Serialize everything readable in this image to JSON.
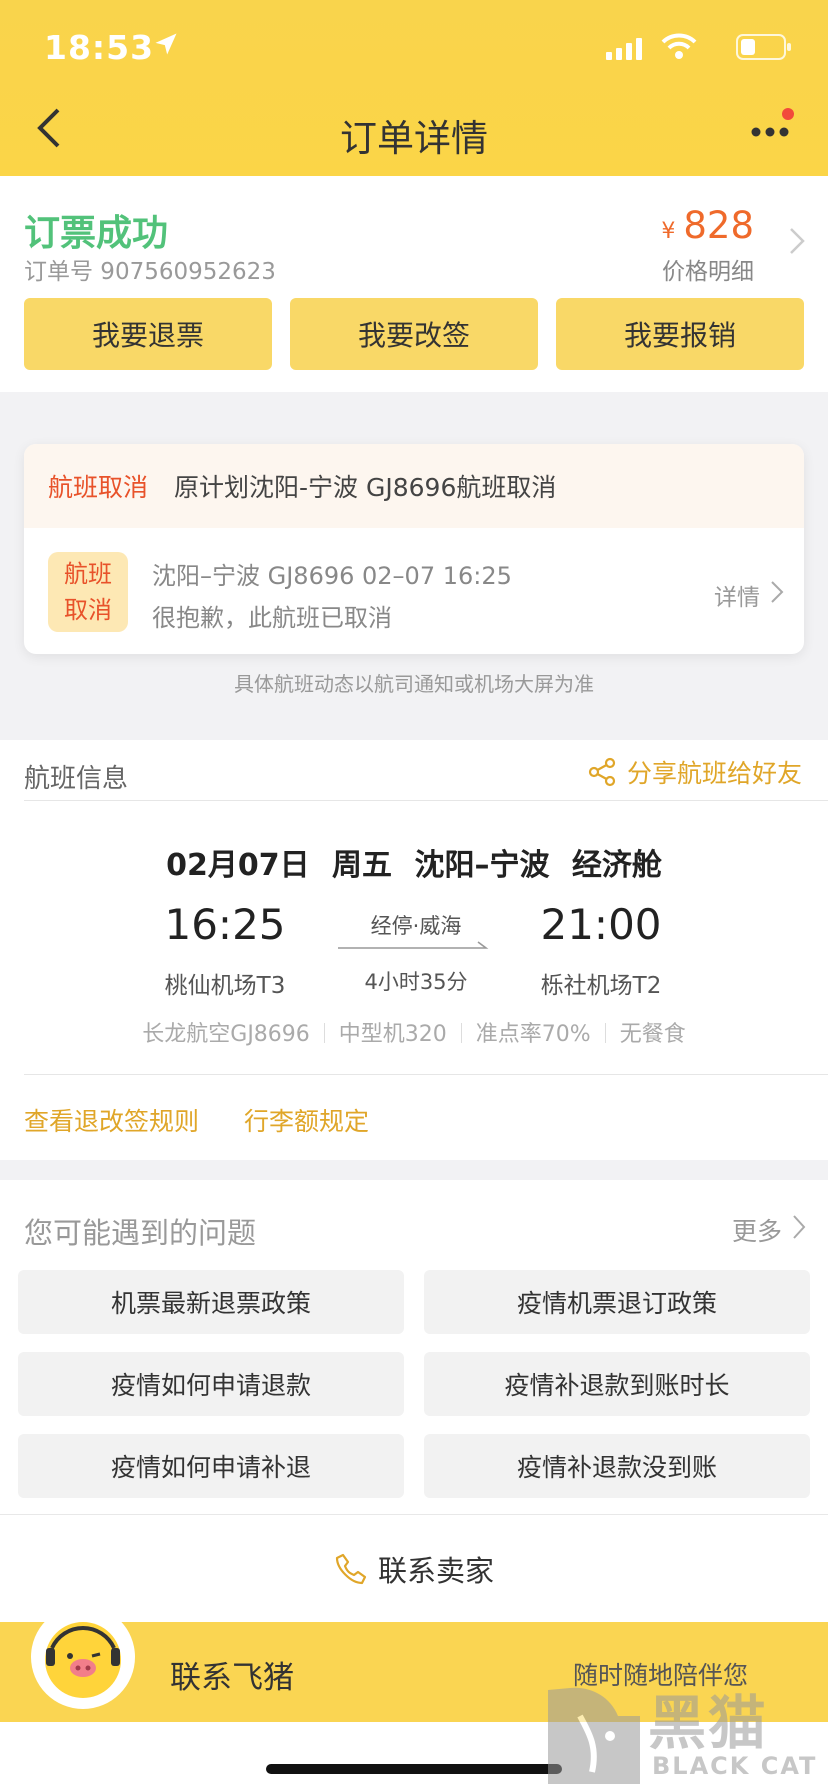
{
  "status_bar": {
    "time": "18:53"
  },
  "nav": {
    "title": "订单详情"
  },
  "order": {
    "status": "订票成功",
    "order_number": "订单号 907560952623",
    "currency": "¥",
    "price": "828",
    "price_detail": "价格明细",
    "actions": [
      "我要退票",
      "我要改签",
      "我要报销"
    ]
  },
  "notice": {
    "tag": "航班取消",
    "message": "原计划沈阳-宁波 GJ8696航班取消",
    "badge_line1": "航班",
    "badge_line2": "取消",
    "flight_line": "沈阳–宁波 GJ8696 02–07 16:25",
    "apology": "很抱歉，此航班已取消",
    "detail_link": "详情",
    "footnote": "具体航班动态以航司通知或机场大屏为准"
  },
  "flight": {
    "section_title": "航班信息",
    "share": "分享航班给好友",
    "header": "02月07日 周五   沈阳–宁波   经济舱",
    "dep_time": "16:25",
    "dep_airport": "桃仙机场T3",
    "arr_time": "21:00",
    "arr_airport": "栎社机场T2",
    "stopover": "经停·威海",
    "duration": "4小时35分",
    "airline": "长龙航空GJ8696",
    "aircraft": "中型机320",
    "ontime": "准点率70%",
    "meal": "无餐食",
    "rules_link": "查看退改签规则",
    "baggage_link": "行李额规定"
  },
  "questions": {
    "title": "您可能遇到的问题",
    "more": "更多",
    "items": [
      "机票最新退票政策",
      "疫情机票退订政策",
      "疫情如何申请退款",
      "疫情补退款到账时长",
      "疫情如何申请补退",
      "疫情补退款没到账"
    ]
  },
  "contact": {
    "seller": "联系卖家"
  },
  "banner": {
    "label": "联系飞猪",
    "sub": "随时随地陪伴您"
  },
  "watermark": {
    "cn": "黑猫",
    "en": "BLACK CAT"
  },
  "colors": {
    "brand_yellow": "#fad552",
    "success_green": "#52c27a",
    "price_orange": "#ef6a2b",
    "link_gold": "#e0a629",
    "cancel_red": "#e8522a"
  }
}
